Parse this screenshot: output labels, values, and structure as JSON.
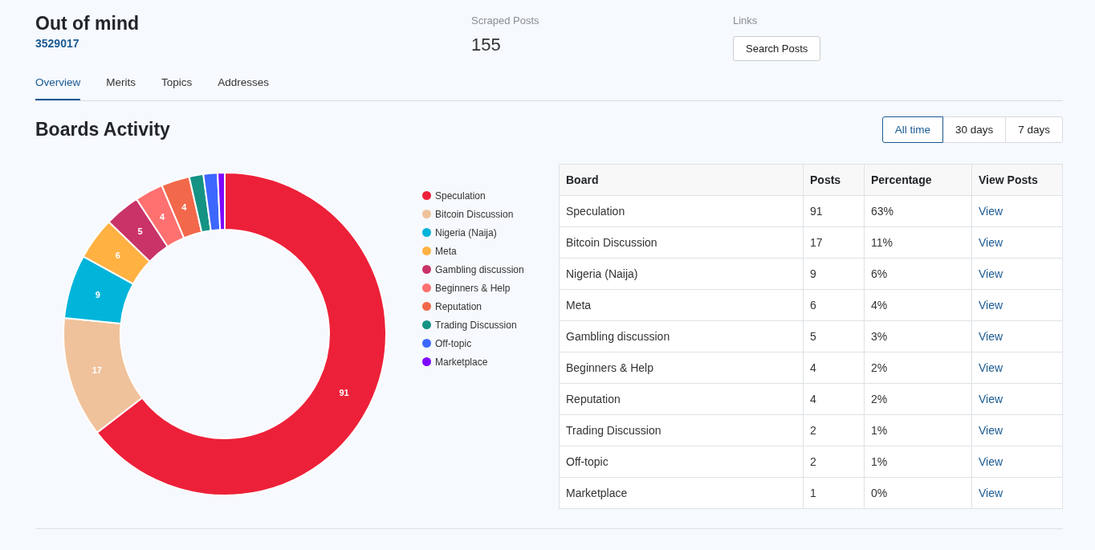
{
  "profile": {
    "name": "Out of mind",
    "user_id": "3529017"
  },
  "scraped": {
    "label": "Scraped Posts",
    "value": "155"
  },
  "links": {
    "label": "Links",
    "button": "Search Posts"
  },
  "tabs": [
    {
      "label": "Overview",
      "selected": true
    },
    {
      "label": "Merits",
      "selected": false
    },
    {
      "label": "Topics",
      "selected": false
    },
    {
      "label": "Addresses",
      "selected": false
    }
  ],
  "boards_activity": {
    "title": "Boards Activity",
    "ranges": [
      {
        "label": "All time",
        "selected": true
      },
      {
        "label": "30 days",
        "selected": false
      },
      {
        "label": "7 days",
        "selected": false
      }
    ],
    "chart_data": {
      "type": "donut",
      "categories": [
        "Speculation",
        "Bitcoin Discussion",
        "Nigeria (Naija)",
        "Meta",
        "Gambling discussion",
        "Beginners & Help",
        "Reputation",
        "Trading Discussion",
        "Off-topic",
        "Marketplace"
      ],
      "values": [
        91,
        17,
        9,
        6,
        5,
        4,
        4,
        2,
        2,
        1
      ],
      "colors": [
        "#ed2039",
        "#f0c29b",
        "#00b4da",
        "#ffb142",
        "#c93368",
        "#ff7070",
        "#f2684a",
        "#149384",
        "#3d67ff",
        "#7e09ff"
      ],
      "value_labels": [
        "91",
        "17",
        "9",
        "6",
        "5",
        "4",
        "4",
        null,
        null,
        null
      ],
      "legend": true
    },
    "table": {
      "columns": [
        "Board",
        "Posts",
        "Percentage",
        "View Posts"
      ],
      "rows": [
        [
          "Speculation",
          "91",
          "63%",
          "View"
        ],
        [
          "Bitcoin Discussion",
          "17",
          "11%",
          "View"
        ],
        [
          "Nigeria (Naija)",
          "9",
          "6%",
          "View"
        ],
        [
          "Meta",
          "6",
          "4%",
          "View"
        ],
        [
          "Gambling discussion",
          "5",
          "3%",
          "View"
        ],
        [
          "Beginners & Help",
          "4",
          "2%",
          "View"
        ],
        [
          "Reputation",
          "4",
          "2%",
          "View"
        ],
        [
          "Trading Discussion",
          "2",
          "1%",
          "View"
        ],
        [
          "Off-topic",
          "2",
          "1%",
          "View"
        ],
        [
          "Marketplace",
          "1",
          "0%",
          "View"
        ]
      ]
    }
  }
}
